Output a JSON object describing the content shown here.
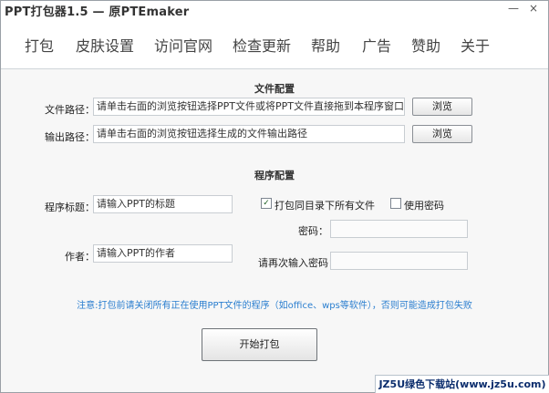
{
  "window": {
    "title": "PPT打包器1.5 — 原PTEmaker",
    "minimize": "—",
    "close": "×"
  },
  "menu": {
    "items": [
      {
        "label": "打包"
      },
      {
        "label": "皮肤设置"
      },
      {
        "label": "访问官网"
      },
      {
        "label": "检查更新"
      },
      {
        "label": "帮助"
      },
      {
        "label": "广告"
      },
      {
        "label": "赞助"
      },
      {
        "label": "关于"
      }
    ]
  },
  "file_config": {
    "section_title": "文件配置",
    "file_path_label": "文件路径：",
    "file_path_value": "请单击右面的浏览按钮选择PPT文件或将PPT文件直接拖到本程序窗口中",
    "browse_1": "浏览",
    "output_path_label": "输出路径：",
    "output_path_value": "请单击右面的浏览按钮选择生成的文件输出路径",
    "browse_2": "浏览"
  },
  "program_config": {
    "section_title": "程序配置",
    "title_label": "程序标题：",
    "title_value": "请输入PPT的标题",
    "author_label": "作者：",
    "author_value": "请输入PPT的作者",
    "pack_all_label": "打包同目录下所有文件",
    "pack_all_checked": true,
    "use_password_label": "使用密码",
    "use_password_checked": false,
    "password_label": "密码：",
    "password_value": "",
    "password_confirm_label": "请再次输入密码：",
    "password_confirm_value": ""
  },
  "notice": "注意:打包前请关闭所有正在使用PPT文件的程序（如office、wps等软件），否则可能造成打包失败",
  "start_button": "开始打包",
  "watermark": "JZ5U绿色下载站(www.jz5u.com)",
  "colors": {
    "notice": "#2a7ecf",
    "check_mark": "#1b5e20"
  }
}
